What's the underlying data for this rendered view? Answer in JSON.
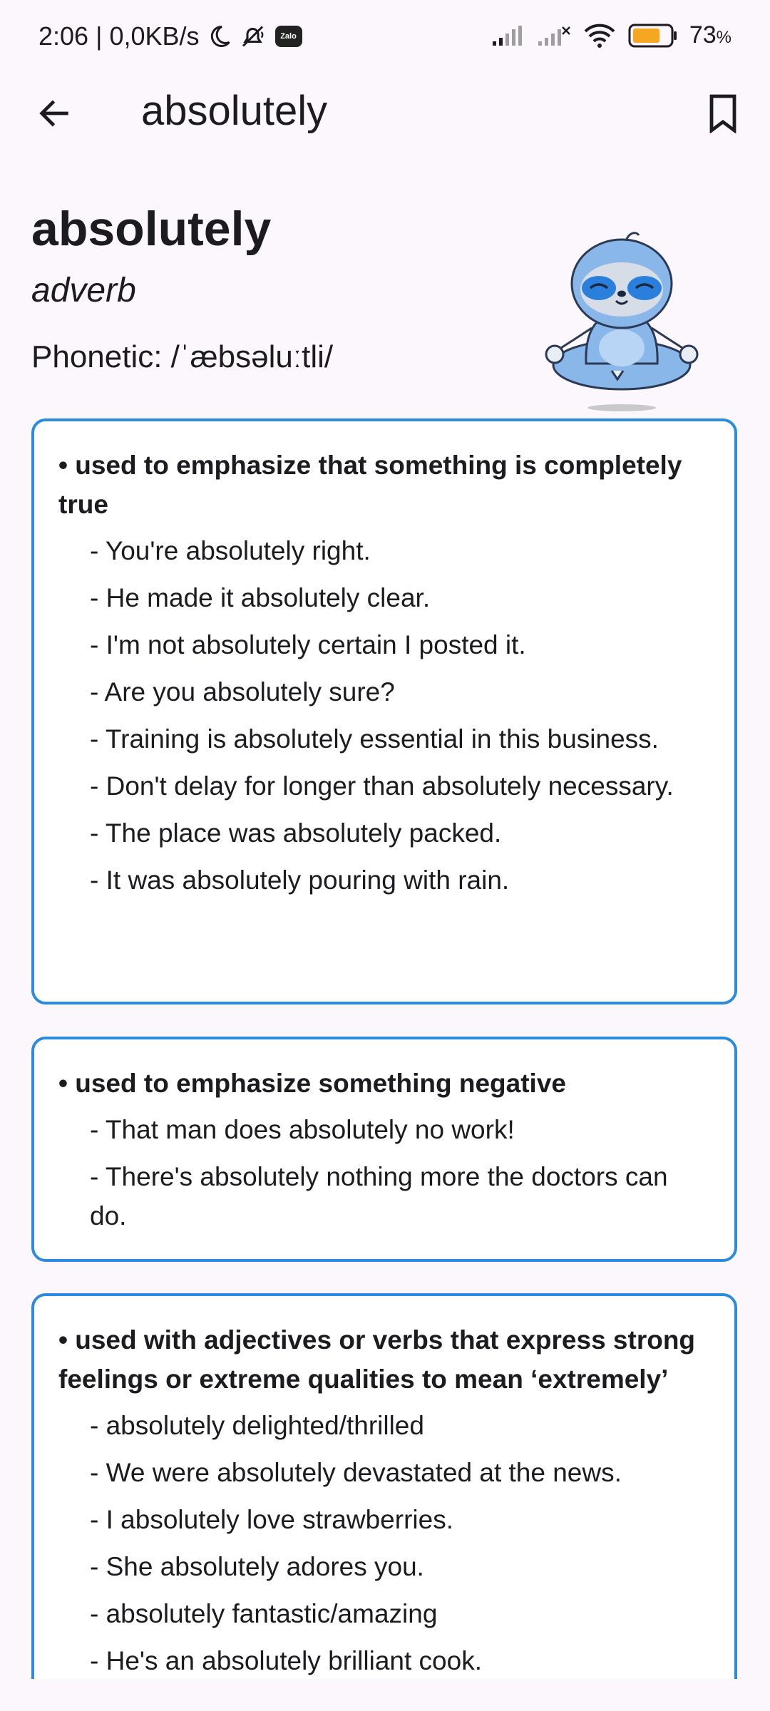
{
  "status_bar": {
    "time": "2:06",
    "separator": "|",
    "network_speed": "0,0KB/s",
    "battery_percent": "73",
    "battery_unit": "%",
    "battery_level": 0.73,
    "battery_color": "#f5a623",
    "icons": [
      "moon-icon",
      "mute-icon",
      "zalo-icon",
      "signal-icon",
      "signal-off-icon",
      "wifi-icon",
      "battery-icon"
    ],
    "zalo_label": "Zalo"
  },
  "app_bar": {
    "title": "absolutely",
    "back_icon": "arrow-left-icon",
    "bookmark_icon": "bookmark-icon"
  },
  "word": {
    "headword": "absolutely",
    "part_of_speech": "adverb",
    "phonetic": "Phonetic: /ˈæbsəluːtli/"
  },
  "mascot": {
    "icon": "sloth-meditating-icon"
  },
  "accent_color": "#2a8be0",
  "senses": [
    {
      "definition": "• used to emphasize that something is completely true",
      "examples": [
        "- You're absolutely right.",
        "- He made it absolutely clear.",
        "- I'm not absolutely certain I posted it.",
        "- Are you absolutely sure?",
        "- Training is absolutely essential in this business.",
        "- Don't delay for longer than absolutely necessary.",
        "- The place was absolutely packed.",
        "- It was absolutely pouring with rain."
      ]
    },
    {
      "definition": "• used to emphasize something negative",
      "examples": [
        "- That man does absolutely no work!",
        "- There's absolutely nothing more the doctors can do."
      ]
    },
    {
      "definition": "• used with adjectives or verbs that express strong feelings or extreme qualities to mean ‘extremely’",
      "examples": [
        "- absolutely delighted/thrilled",
        "- We were absolutely devastated at the news.",
        "- I absolutely love strawberries.",
        "- She absolutely adores you.",
        "- absolutely fantastic/amazing",
        "- He's an absolutely brilliant cook."
      ]
    }
  ]
}
